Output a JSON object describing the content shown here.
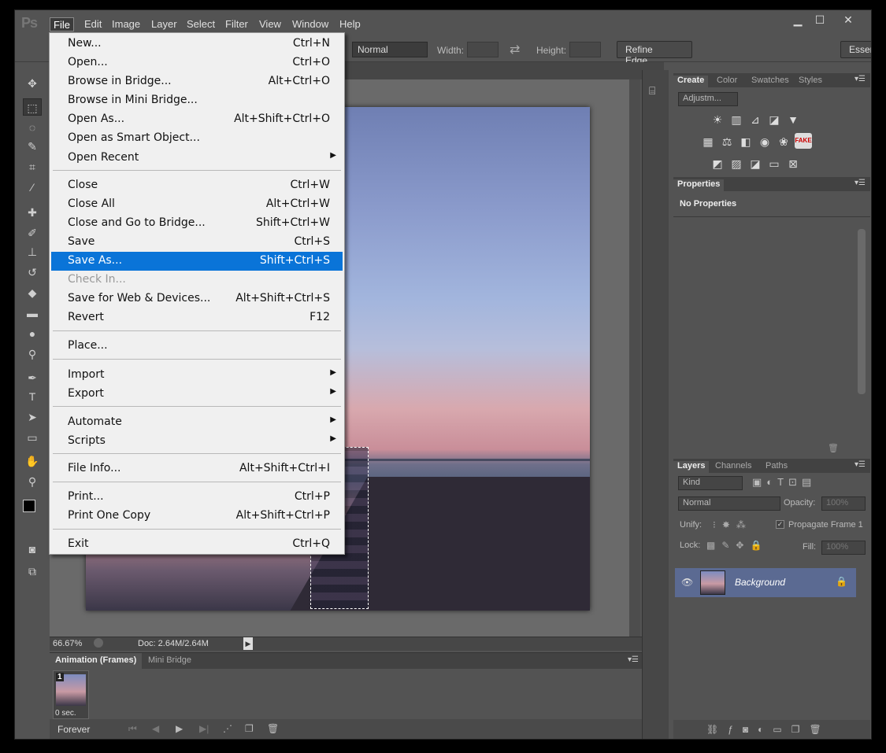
{
  "menubar": {
    "logo": "Ps",
    "items": [
      "File",
      "Edit",
      "Image",
      "Layer",
      "Select",
      "Filter",
      "View",
      "Window",
      "Help"
    ]
  },
  "window_controls": {
    "minimize": "▁",
    "maximize": "☐",
    "close": "✕"
  },
  "options": {
    "style_value": "Normal",
    "width_label": "Width:",
    "height_label": "Height:",
    "refine_edge": "Refine Edge...",
    "workspace": "Essen"
  },
  "file_menu": {
    "items": [
      {
        "label": "New...",
        "shortcut": "Ctrl+N"
      },
      {
        "label": "Open...",
        "shortcut": "Ctrl+O"
      },
      {
        "label": "Browse in Bridge...",
        "shortcut": "Alt+Ctrl+O"
      },
      {
        "label": "Browse in Mini Bridge...",
        "shortcut": ""
      },
      {
        "label": "Open As...",
        "shortcut": "Alt+Shift+Ctrl+O"
      },
      {
        "label": "Open as Smart Object...",
        "shortcut": ""
      },
      {
        "label": "Open Recent",
        "shortcut": ""
      },
      {
        "label": "Close",
        "shortcut": "Ctrl+W"
      },
      {
        "label": "Close All",
        "shortcut": "Alt+Ctrl+W"
      },
      {
        "label": "Close and Go to Bridge...",
        "shortcut": "Shift+Ctrl+W"
      },
      {
        "label": "Save",
        "shortcut": "Ctrl+S"
      },
      {
        "label": "Save As...",
        "shortcut": "Shift+Ctrl+S"
      },
      {
        "label": "Check In...",
        "shortcut": ""
      },
      {
        "label": "Save for Web & Devices...",
        "shortcut": "Alt+Shift+Ctrl+S"
      },
      {
        "label": "Revert",
        "shortcut": "F12"
      },
      {
        "label": "Place...",
        "shortcut": ""
      },
      {
        "label": "Import",
        "shortcut": ""
      },
      {
        "label": "Export",
        "shortcut": ""
      },
      {
        "label": "Automate",
        "shortcut": ""
      },
      {
        "label": "Scripts",
        "shortcut": ""
      },
      {
        "label": "File Info...",
        "shortcut": "Alt+Shift+Ctrl+I"
      },
      {
        "label": "Print...",
        "shortcut": "Ctrl+P"
      },
      {
        "label": "Print One Copy",
        "shortcut": "Alt+Shift+Ctrl+P"
      },
      {
        "label": "Exit",
        "shortcut": "Ctrl+Q"
      }
    ]
  },
  "status": {
    "zoom": "66.67%",
    "doc": "Doc: 2.64M/2.64M"
  },
  "animation": {
    "tabs": [
      "Animation (Frames)",
      "Mini Bridge"
    ],
    "frame_number": "1",
    "frame_time": "0 sec.",
    "loop": "Forever"
  },
  "adjust_panel": {
    "tabs": [
      "Create",
      "Color",
      "Swatches",
      "Styles"
    ],
    "dropdown": "Adjustm...",
    "fake_badge": "FAKE"
  },
  "properties_panel": {
    "tab": "Properties",
    "text": "No Properties"
  },
  "layers_panel": {
    "tabs": [
      "Layers",
      "Channels",
      "Paths"
    ],
    "kind": "Kind",
    "blend_mode": "Normal",
    "opacity_label": "Opacity:",
    "opacity_value": "100%",
    "unify_label": "Unify:",
    "propagate": "Propagate Frame 1",
    "lock_label": "Lock:",
    "fill_label": "Fill:",
    "fill_value": "100%",
    "layer_name": "Background"
  },
  "colors": {
    "highlight": "#0a74d8",
    "ui_bg": "#535353",
    "layer_selected": "#5b6a92"
  }
}
